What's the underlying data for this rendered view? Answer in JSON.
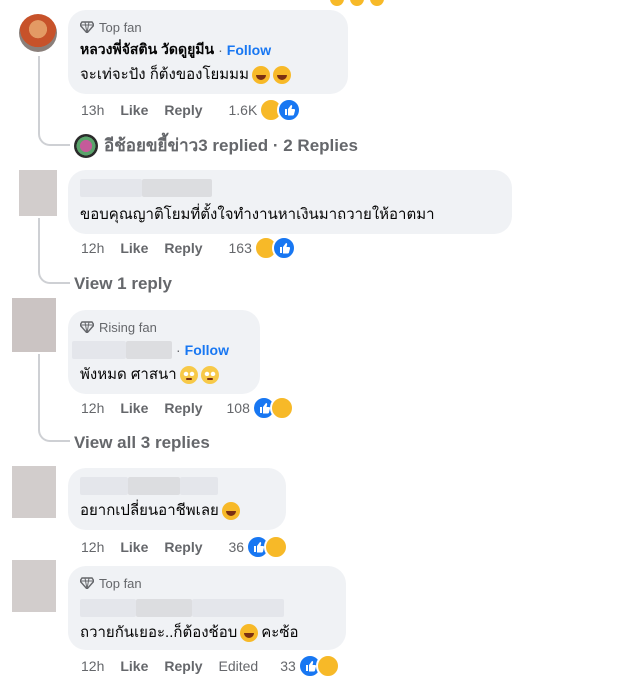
{
  "comments": [
    {
      "badge": "Top fan",
      "name": "หลวงพี่จัสติน วัดดูยูมีน",
      "follow": "Follow",
      "text": "จะเท่จะปัง ก็ต้งของโยมมม",
      "time": "13h",
      "like": "Like",
      "reply": "Reply",
      "count": "1.6K",
      "reply_summary_name": "อีช้อยขยี้ข่าว",
      "reply_summary_text": "3 replied · 2 Replies"
    },
    {
      "text": "ขอบคุณญาติโยมที่ตั้งใจทำงานหาเงินมาถวายให้อาตมา",
      "time": "12h",
      "like": "Like",
      "reply": "Reply",
      "count": "163",
      "view_replies": "View 1 reply"
    },
    {
      "badge": "Rising fan",
      "follow": "Follow",
      "text": "พังหมด ศาสนา",
      "time": "12h",
      "like": "Like",
      "reply": "Reply",
      "count": "108",
      "view_replies": "View all 3 replies"
    },
    {
      "text": "อยากเปลี่ยนอาชีพเลย",
      "time": "12h",
      "like": "Like",
      "reply": "Reply",
      "count": "36"
    },
    {
      "badge": "Top fan",
      "text": "ถวายกันเยอะ..ก็ต้องช้อบ",
      "text_suffix": "คะซ้อ",
      "time": "12h",
      "like": "Like",
      "reply": "Reply",
      "edited": "Edited",
      "count": "33"
    }
  ],
  "icons": {
    "badge": "diamond-icon",
    "like_reaction": "like-reaction-icon",
    "haha_reaction": "haha-reaction-icon"
  },
  "colors": {
    "follow": "#1877f2",
    "meta": "#65676b",
    "bubble": "#f0f2f5",
    "like": "#1877f2",
    "haha": "#f7b928"
  }
}
